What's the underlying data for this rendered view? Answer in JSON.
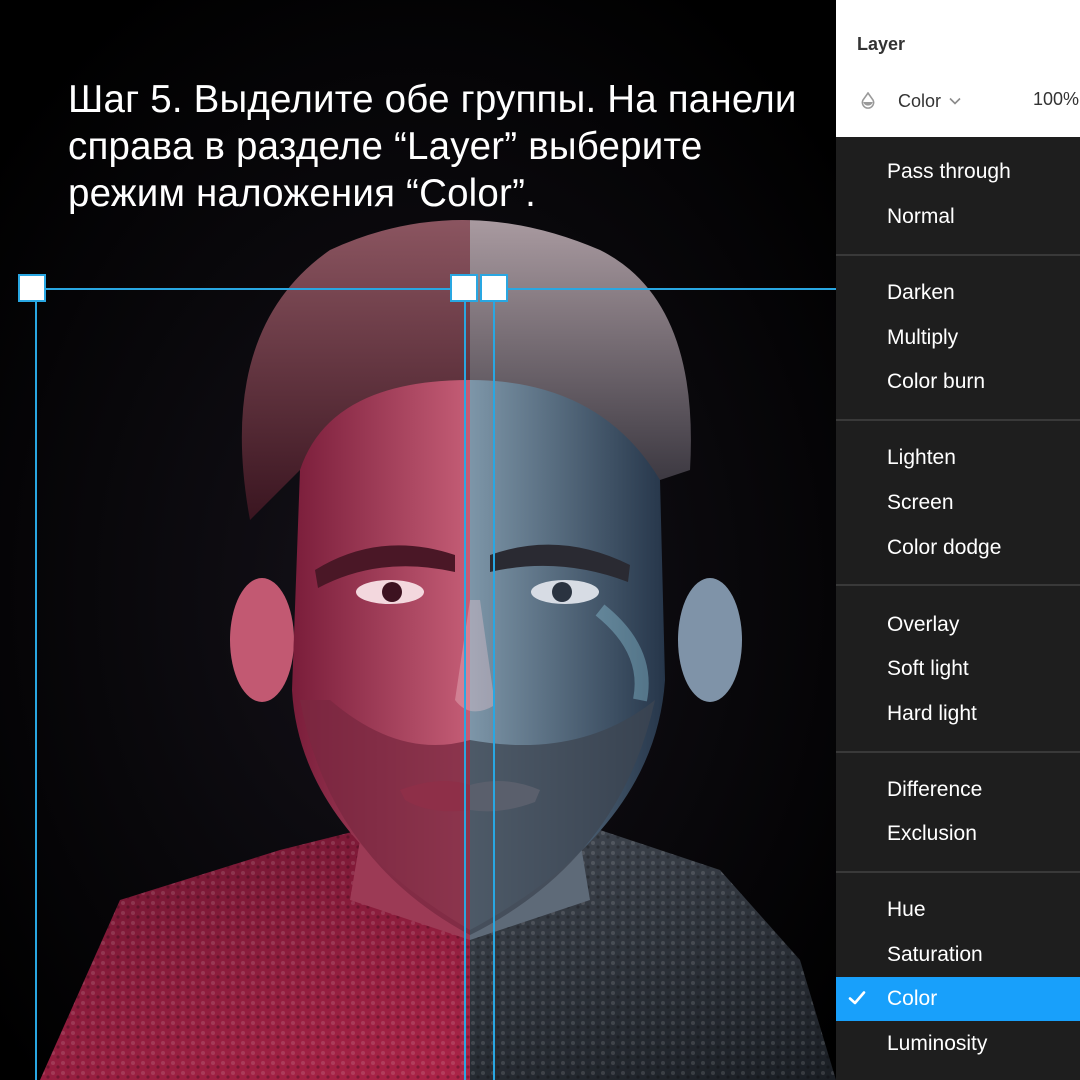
{
  "instruction": "Шаг 5. Выделите обе группы. На панели справа в разделе “Layer” выберите режим наложения “Color”.",
  "layer_panel": {
    "title": "Layer",
    "blend_mode": "Color",
    "opacity": "100%"
  },
  "blend_menu": {
    "groups": [
      [
        "Pass through",
        "Normal"
      ],
      [
        "Darken",
        "Multiply",
        "Color burn"
      ],
      [
        "Lighten",
        "Screen",
        "Color dodge"
      ],
      [
        "Overlay",
        "Soft light",
        "Hard light"
      ],
      [
        "Difference",
        "Exclusion"
      ],
      [
        "Hue",
        "Saturation",
        "Color",
        "Luminosity"
      ]
    ],
    "selected": "Color"
  },
  "icons": {
    "blend": "drop-icon",
    "dropdown": "chevron-down-icon",
    "selected": "check-icon"
  },
  "colors": {
    "selection": "#29a7e2",
    "menu_bg": "#1e1e1e",
    "menu_selected": "#18a0fb",
    "tint_left": "#e23a6a",
    "tint_right": "#4bb9d6"
  }
}
